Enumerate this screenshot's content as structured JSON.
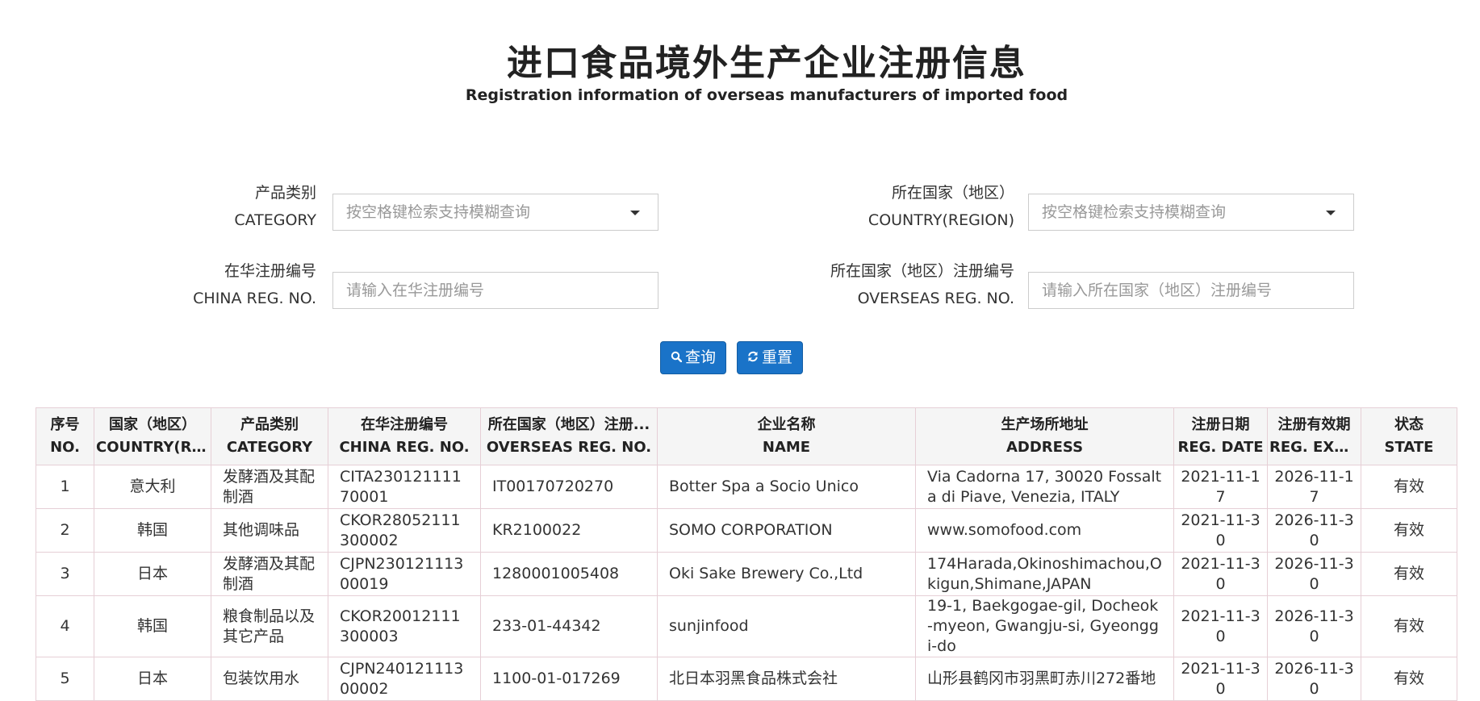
{
  "header": {
    "title_zh": "进口食品境外生产企业注册信息",
    "title_en": "Registration information of overseas manufacturers of imported food"
  },
  "filters": {
    "category": {
      "label_zh": "产品类别",
      "label_en": "CATEGORY",
      "placeholder": "按空格键检索支持模糊查询"
    },
    "country": {
      "label_zh": "所在国家（地区）",
      "label_en": "COUNTRY(REGION)",
      "placeholder": "按空格键检索支持模糊查询"
    },
    "china_reg": {
      "label_zh": "在华注册编号",
      "label_en": "CHINA REG. NO.",
      "placeholder": "请输入在华注册编号"
    },
    "overseas_reg": {
      "label_zh": "所在国家（地区）注册编号",
      "label_en": "OVERSEAS REG. NO.",
      "placeholder": "请输入所在国家（地区）注册编号"
    }
  },
  "buttons": {
    "search": "查询",
    "reset": "重置"
  },
  "table": {
    "columns": [
      {
        "zh": "序号",
        "en": "NO."
      },
      {
        "zh": "国家（地区）",
        "en": "COUNTRY(REGI..."
      },
      {
        "zh": "产品类别",
        "en": "CATEGORY"
      },
      {
        "zh": "在华注册编号",
        "en": "CHINA REG. NO."
      },
      {
        "zh": "所在国家（地区）注册...",
        "en": "OVERSEAS REG. NO."
      },
      {
        "zh": "企业名称",
        "en": "NAME"
      },
      {
        "zh": "生产场所地址",
        "en": "ADDRESS"
      },
      {
        "zh": "注册日期",
        "en": "REG. DATE"
      },
      {
        "zh": "注册有效期",
        "en": "REG. EXPIR..."
      },
      {
        "zh": "状态",
        "en": "STATE"
      }
    ],
    "rows": [
      {
        "no": "1",
        "country": "意大利",
        "category": "发酵酒及其配制酒",
        "china_reg": "CITA23012111170001",
        "overseas_reg": "IT00170720270",
        "name": "Botter Spa a Socio Unico",
        "address": "Via Cadorna 17, 30020 Fossalta di Piave, Venezia, ITALY",
        "reg_date": "2021-11-17",
        "expiry": "2026-11-17",
        "state": "有效"
      },
      {
        "no": "2",
        "country": "韩国",
        "category": "其他调味品",
        "china_reg": "CKOR28052111300002",
        "overseas_reg": "KR2100022",
        "name": "SOMO CORPORATION",
        "address": "www.somofood.com",
        "reg_date": "2021-11-30",
        "expiry": "2026-11-30",
        "state": "有效"
      },
      {
        "no": "3",
        "country": "日本",
        "category": "发酵酒及其配制酒",
        "china_reg": "CJPN23012111300019",
        "overseas_reg": "1280001005408",
        "name": "Oki Sake Brewery Co.,Ltd",
        "address": "174Harada,Okinoshimachou,Okigun,Shimane,JAPAN",
        "reg_date": "2021-11-30",
        "expiry": "2026-11-30",
        "state": "有效"
      },
      {
        "no": "4",
        "country": "韩国",
        "category": "粮食制品以及其它产品",
        "china_reg": "CKOR20012111300003",
        "overseas_reg": "233-01-44342",
        "name": "sunjinfood",
        "address": "19-1, Baekgogae-gil, Docheok-myeon, Gwangju-si, Gyeonggi-do",
        "reg_date": "2021-11-30",
        "expiry": "2026-11-30",
        "state": "有效"
      },
      {
        "no": "5",
        "country": "日本",
        "category": "包装饮用水",
        "china_reg": "CJPN24012111300002",
        "overseas_reg": "1100-01-017269",
        "name": "北日本羽黑食品株式会社",
        "address": "山形县鹤冈市羽黑町赤川272番地",
        "reg_date": "2021-11-30",
        "expiry": "2026-11-30",
        "state": "有效"
      }
    ]
  }
}
